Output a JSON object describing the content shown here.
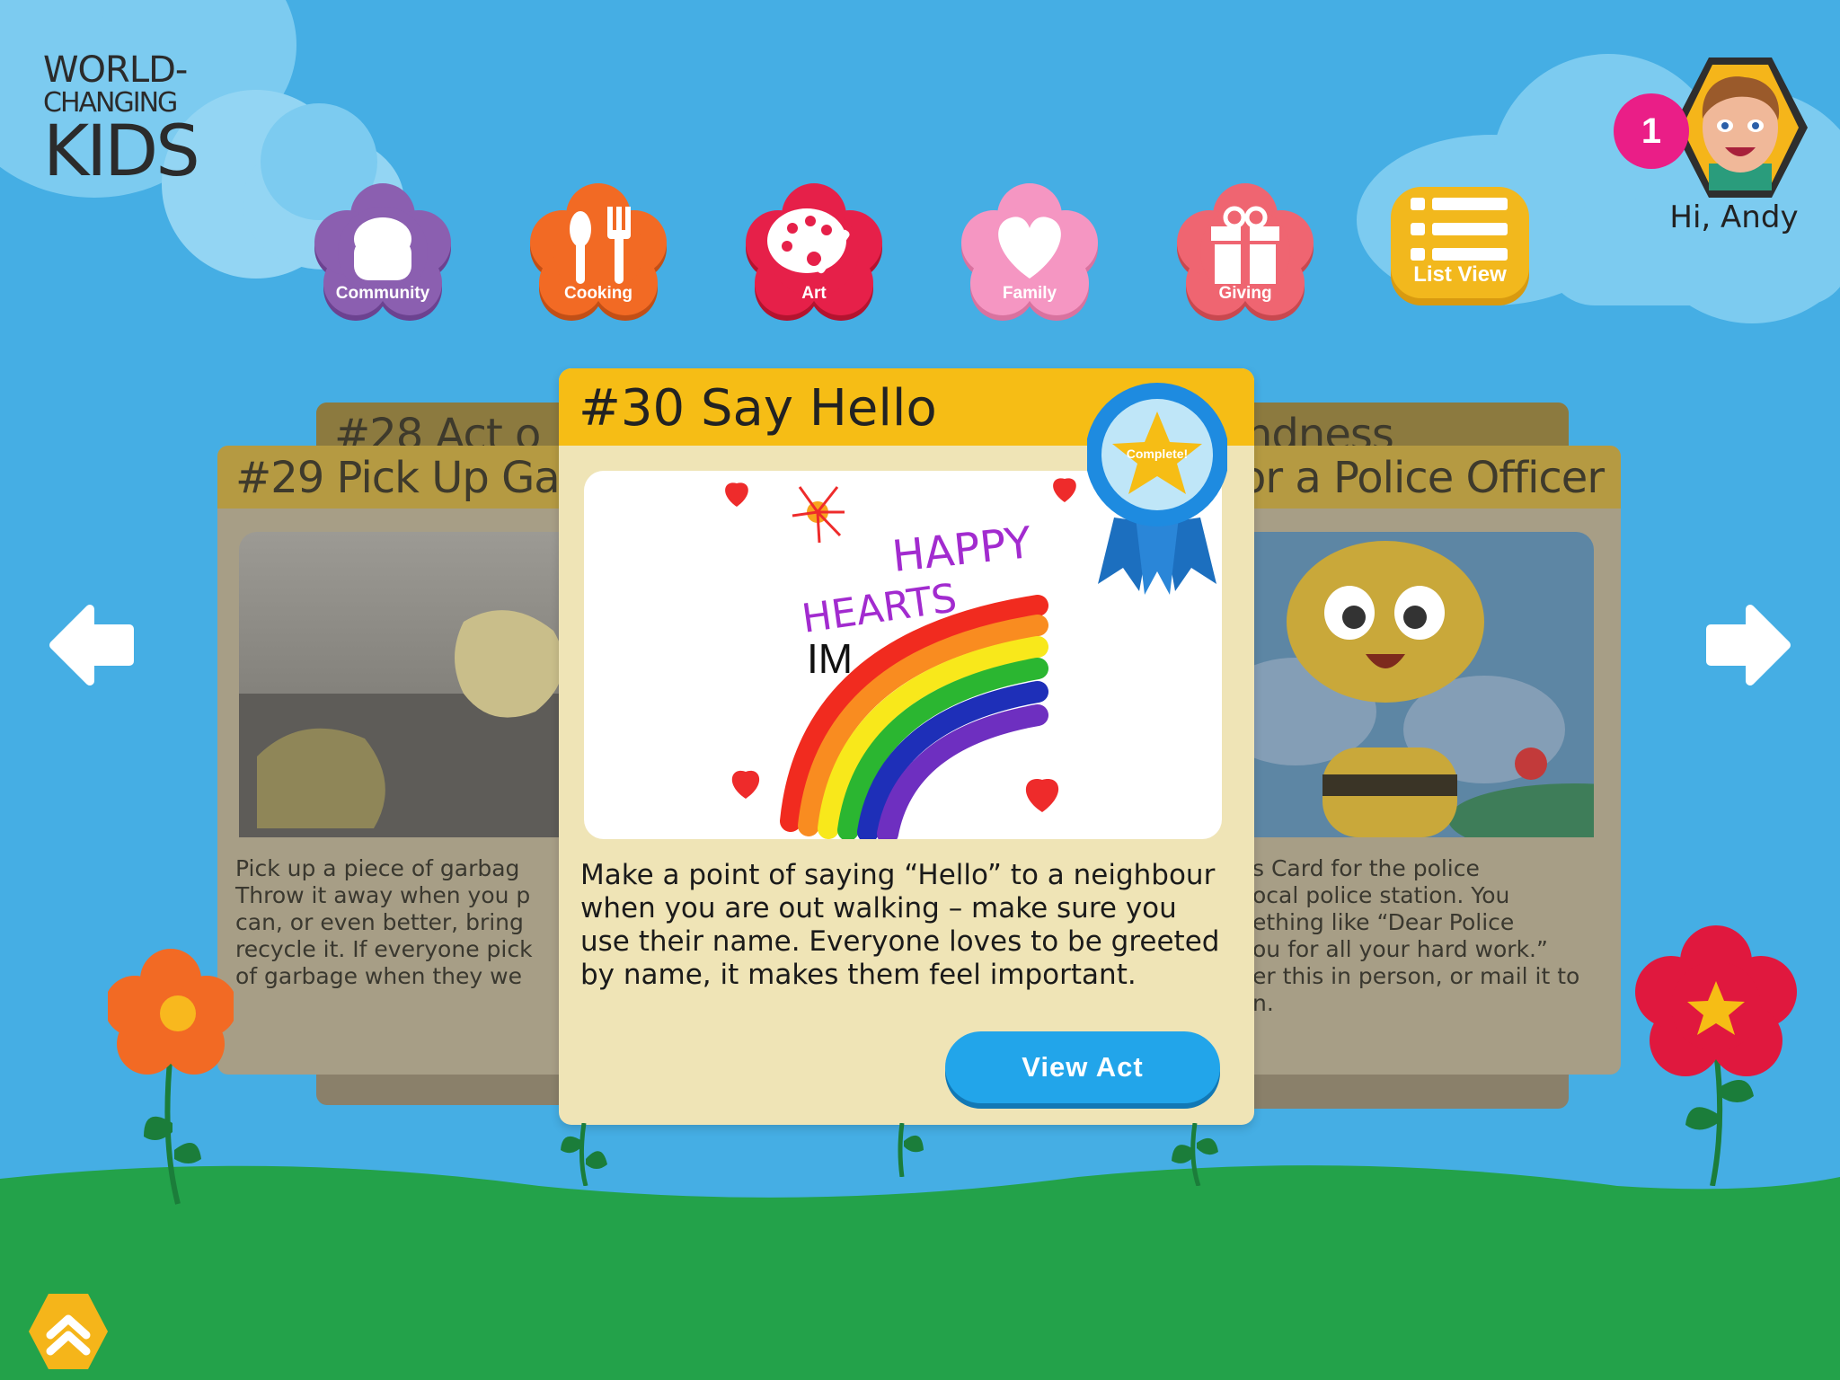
{
  "logo": {
    "line1": "WORLD-",
    "line2": "CHANGING",
    "line3": "KIDS"
  },
  "categories": [
    {
      "label": "Community",
      "color": "#8b5fb0"
    },
    {
      "label": "Cooking",
      "color": "#f26a24"
    },
    {
      "label": "Art",
      "color": "#e62049"
    },
    {
      "label": "Family",
      "color": "#f596c2"
    },
    {
      "label": "Giving",
      "color": "#ef6571"
    }
  ],
  "list_view": {
    "label": "List View",
    "color": "#f2b81d"
  },
  "user": {
    "notification_count": "1",
    "greeting": "Hi, Andy"
  },
  "cards": {
    "back_left_title": "#28 Act o",
    "back_right_title": "ndness",
    "left": {
      "title": "#29 Pick Up Gar",
      "body": "Pick up a piece of garbag\nThrow it away when you p\ncan, or even better, bring\nrecycle it. If everyone pick\nof garbage when they we"
    },
    "right": {
      "title": "or a Police Officer",
      "body": "s Card for the police\nocal police station. You\nething like “Dear Police\nou for all your hard work.”\ner this in person, or mail it to\nn."
    },
    "main": {
      "title": "#30 Say Hello",
      "complete_label": "Complete!",
      "drawing_text_happy": "HAPPY",
      "drawing_text_hearts": "HEARTS",
      "drawing_text_im": "IM",
      "body": "Make a point of saying “Hello” to a neighbour when you are out walking – make sure you use their name. Everyone loves to be greeted by name, it makes them feel important.",
      "button": "View Act"
    }
  },
  "colors": {
    "sky": "#45aee4",
    "grass": "#23a24a",
    "header_yellow": "#f6bd15",
    "button_blue": "#22a5ea"
  }
}
